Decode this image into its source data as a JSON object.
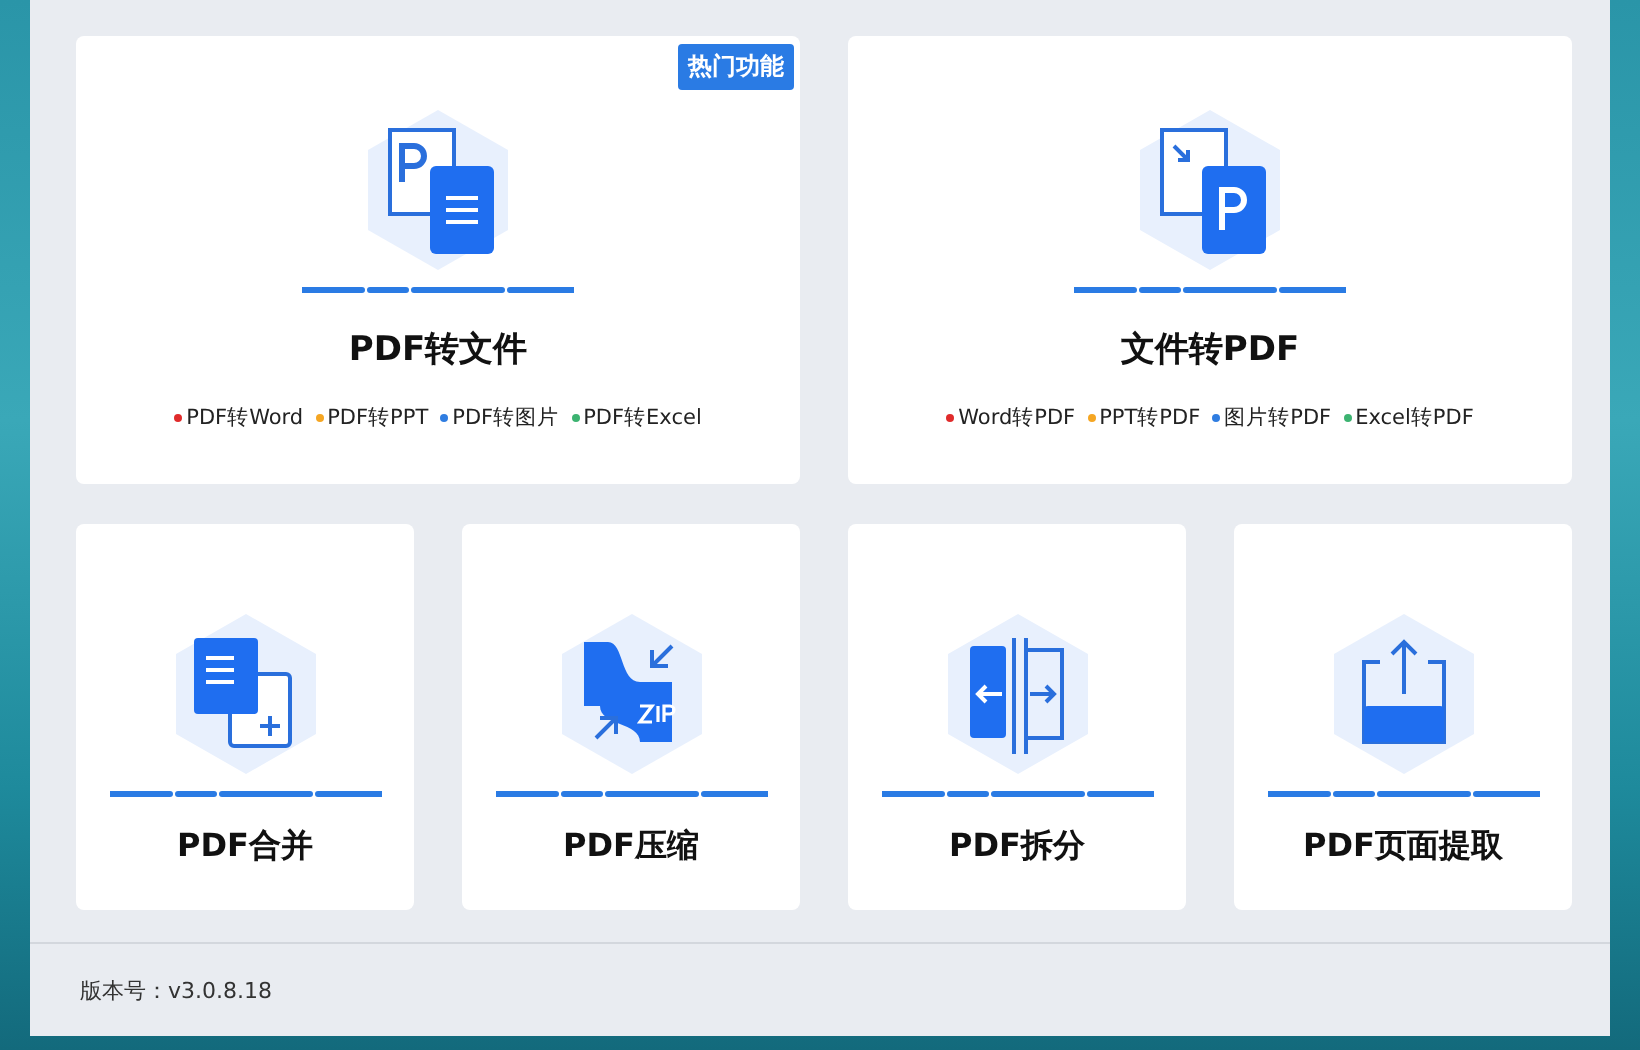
{
  "main_cards": [
    {
      "title": "PDF转文件",
      "badge": "热门功能",
      "formats": [
        {
          "label": "PDF转Word",
          "color": "#e02b2b"
        },
        {
          "label": "PDF转PPT",
          "color": "#f5a623"
        },
        {
          "label": "PDF转图片",
          "color": "#2f7de1"
        },
        {
          "label": "PDF转Excel",
          "color": "#3cb371"
        }
      ]
    },
    {
      "title": "文件转PDF",
      "formats": [
        {
          "label": "Word转PDF",
          "color": "#e02b2b"
        },
        {
          "label": "PPT转PDF",
          "color": "#f5a623"
        },
        {
          "label": "图片转PDF",
          "color": "#2f7de1"
        },
        {
          "label": "Excel转PDF",
          "color": "#3cb371"
        }
      ]
    }
  ],
  "tool_cards": [
    {
      "title": "PDF合并"
    },
    {
      "title": "PDF压缩"
    },
    {
      "title": "PDF拆分"
    },
    {
      "title": "PDF页面提取"
    }
  ],
  "status_bar": {
    "version": "版本号：v3.0.8.18"
  }
}
